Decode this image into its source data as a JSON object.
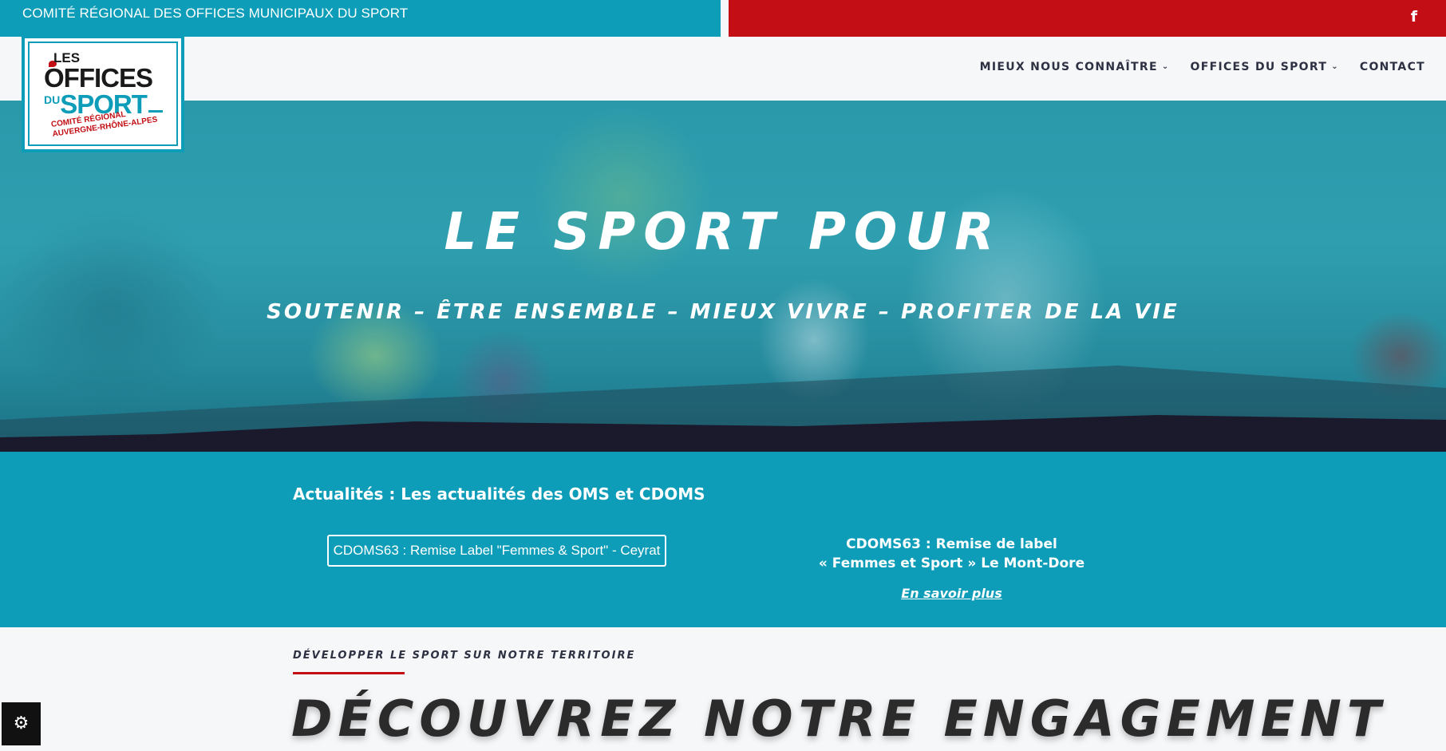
{
  "topbar": {
    "title": "COMITÉ RÉGIONAL DES OFFICES MUNICIPAUX DU SPORT",
    "social_icon": "f"
  },
  "logo": {
    "line1": "LES",
    "line2": "OFFICES",
    "line3a": "DU",
    "line3b": "SPORT",
    "sub1": "COMITÉ RÉGIONAL",
    "sub2": "AUVERGNE-RHÔNE-ALPES"
  },
  "nav": {
    "items": [
      {
        "label": "MIEUX NOUS CONNAÎTRE",
        "has_dropdown": true
      },
      {
        "label": "OFFICES DU SPORT",
        "has_dropdown": true
      },
      {
        "label": "CONTACT",
        "has_dropdown": false
      }
    ],
    "chevron": "⌄"
  },
  "hero": {
    "title": "LE SPORT POUR",
    "subtitle": "SOUTENIR – ÊTRE ENSEMBLE – MIEUX VIVRE – PROFITER DE LA VIE"
  },
  "news": {
    "heading": "Actualités : Les actualités des OMS et CDOMS",
    "button": "CDOMS63 : Remise Label \"Femmes & Sport\" - Ceyrat",
    "item_line1": "CDOMS63 : Remise de label",
    "item_line2": "« Femmes et Sport » Le Mont-Dore",
    "link": "En savoir plus"
  },
  "section": {
    "kicker": "DÉVELOPPER LE SPORT SUR NOTRE TERRITOIRE",
    "title": "DÉCOUVREZ NOTRE ENGAGEMENT"
  },
  "settings": {
    "icon": "⚙"
  },
  "colors": {
    "teal": "#0d9db8",
    "red": "#c20e14",
    "navy": "#1b1a2c",
    "text_dark": "#2d3142"
  }
}
